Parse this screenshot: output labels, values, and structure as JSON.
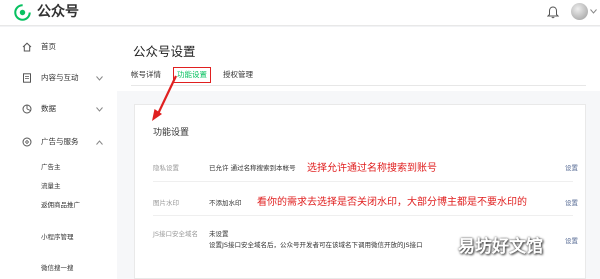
{
  "app": {
    "title": "公众号"
  },
  "sidebar": {
    "items": [
      {
        "label": "首页",
        "icon": "home-icon"
      },
      {
        "label": "内容与互动",
        "icon": "document-icon"
      },
      {
        "label": "数据",
        "icon": "chart-icon"
      },
      {
        "label": "广告与服务",
        "icon": "ad-icon"
      }
    ],
    "sub_items": [
      "广告主",
      "流量主",
      "返佣商品推广",
      "小程序管理",
      "微信搜一搜"
    ]
  },
  "main": {
    "page_title": "公众号设置",
    "tabs": [
      {
        "label": "帐号详情",
        "active": false
      },
      {
        "label": "功能设置",
        "active": true
      },
      {
        "label": "授权管理",
        "active": false
      }
    ]
  },
  "panel": {
    "title": "功能设置",
    "rows": [
      {
        "label": "隐私设置",
        "value": "已允许 通过名称搜索到本帐号",
        "note": "选择允许通过名称搜索到账号",
        "action": "设置"
      },
      {
        "label": "图片水印",
        "value": "不添加水印",
        "note": "看你的需求去选择是否关闭水印，大部分博主都是不要水印的",
        "action": "设置"
      },
      {
        "label": "JS接口安全域名",
        "value": "未设置",
        "value2": "设置JS接口安全域名后，公众号开发者可在该域名下调用微信开放的JS接口",
        "action": "设置"
      }
    ]
  },
  "watermark": "易坊好文馆",
  "colors": {
    "accent": "#07c160",
    "annotation": "#e02020",
    "link": "#576b95"
  }
}
